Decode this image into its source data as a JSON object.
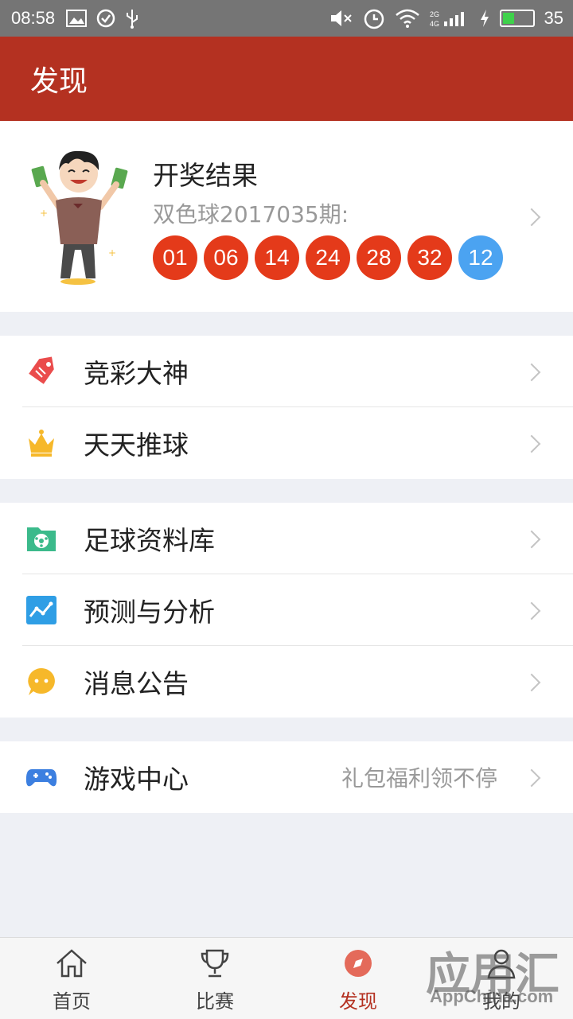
{
  "status": {
    "time": "08:58",
    "battery": "35"
  },
  "header": {
    "title": "发现"
  },
  "lottery": {
    "title": "开奖结果",
    "subtitle": "双色球2017035期:",
    "red_balls": [
      "01",
      "06",
      "14",
      "24",
      "28",
      "32"
    ],
    "blue_ball": "12",
    "colors": {
      "red": "#e43a1a",
      "blue": "#4ba3f1"
    }
  },
  "menu": {
    "section1": [
      {
        "label": "竞彩大神",
        "icon": "tag-icon"
      },
      {
        "label": "天天推球",
        "icon": "crown-icon"
      }
    ],
    "section2": [
      {
        "label": "足球资料库",
        "icon": "folder-soccer-icon"
      },
      {
        "label": "预测与分析",
        "icon": "chart-icon"
      },
      {
        "label": "消息公告",
        "icon": "chat-bubble-icon"
      }
    ],
    "section3": [
      {
        "label": "游戏中心",
        "icon": "gamepad-icon",
        "extra": "礼包福利领不停"
      }
    ]
  },
  "tabbar": {
    "items": [
      {
        "label": "首页",
        "icon": "home-icon"
      },
      {
        "label": "比赛",
        "icon": "trophy-icon"
      },
      {
        "label": "发现",
        "icon": "discover-icon"
      },
      {
        "label": "我的",
        "icon": "user-icon"
      }
    ]
  },
  "watermark": {
    "text": "应用汇",
    "sub": "AppChina.com"
  },
  "accent": "#b43121"
}
